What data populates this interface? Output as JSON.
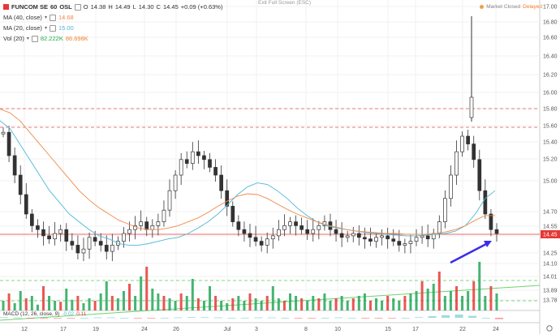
{
  "header": {
    "symbol": "FUNCOM SE",
    "interval": "60",
    "exchange": "OSL",
    "open_label": "O",
    "open": "14.38",
    "high_label": "H",
    "high": "14.49",
    "low_label": "L",
    "low": "14.30",
    "close_label": "C",
    "close": "14.45",
    "change": "+0.09 (+0.63%)",
    "exit_full_screen": "Exit Full Screen (ESC)",
    "market_status": "Market Closed",
    "delayed": "Delayed"
  },
  "indicators": {
    "ma40": {
      "label": "MA (40, close)",
      "value": "14.68",
      "color": "#f08a4b"
    },
    "ma20": {
      "label": "MA (20, close)",
      "value": "15.00",
      "color": "#4fb8d8"
    },
    "vol": {
      "label": "Vol (20)",
      "value_up": "82.222K",
      "value_down": "86.698K",
      "up_color": "#22aa44",
      "down_color": "#f08030"
    },
    "macd": {
      "label": "MACD (12, 26, close, 9)",
      "v1": "-0.02",
      "v2": "0.11"
    }
  },
  "colors": {
    "up": "#26a65b",
    "down": "#e53935",
    "candle": "#333333",
    "price_tag": "#e53935",
    "arrow": "#3a2ee8",
    "trend": "#6dd36d",
    "support": "#55cc55",
    "resistance": "#e05050"
  },
  "chart_data": {
    "type": "candlestick",
    "title": "FUNCOM SE, 60, OSL",
    "x_tick_labels": [
      "12",
      "17",
      "19",
      "24",
      "26",
      "Jul",
      "3",
      "8",
      "10",
      "15",
      "17",
      "22",
      "24"
    ],
    "y_tick_labels": [
      "17.00",
      "16.80",
      "16.60",
      "16.40",
      "16.20",
      "16.00",
      "15.80",
      "15.60",
      "15.40",
      "15.20",
      "15.00",
      "14.70",
      "14.55",
      "14.45",
      "14.25",
      "14.10",
      "14.01",
      "13.89",
      "13.78"
    ],
    "ylim": [
      13.72,
      17.02
    ],
    "last_price": 14.45,
    "resistance_levels": [
      15.8,
      15.6
    ],
    "support_levels": [
      14.2,
      14.01
    ],
    "trendline": {
      "from": [
        0,
        13.95
      ],
      "to": [
        1,
        14.17
      ]
    },
    "close_series": [
      15.75,
      15.45,
      15.2,
      14.95,
      14.7,
      14.55,
      14.5,
      14.42,
      14.38,
      14.45,
      14.5,
      14.35,
      14.3,
      14.2,
      14.25,
      14.4,
      14.35,
      14.3,
      14.22,
      14.3,
      14.35,
      14.45,
      14.5,
      14.55,
      14.6,
      14.5,
      14.55,
      14.6,
      14.75,
      15.0,
      15.2,
      15.4,
      15.35,
      15.5,
      15.45,
      15.4,
      15.3,
      15.2,
      15.0,
      14.8,
      14.6,
      14.5,
      14.45,
      14.4,
      14.35,
      14.3,
      14.38,
      14.42,
      14.5,
      14.55,
      14.6,
      14.55,
      14.5,
      14.45,
      14.5,
      14.55,
      14.6,
      14.5,
      14.45,
      14.4,
      14.42,
      14.45,
      14.4,
      14.38,
      14.35,
      14.4,
      14.42,
      14.38,
      14.35,
      14.3,
      14.32,
      14.35,
      14.4,
      14.42,
      14.38,
      14.45,
      14.6,
      14.9,
      15.2,
      15.5,
      15.7,
      15.6,
      15.4,
      15.0,
      14.7,
      14.5,
      14.45
    ],
    "ma20_series": [
      15.9,
      15.8,
      15.6,
      15.4,
      15.2,
      15.0,
      14.85,
      14.7,
      14.6,
      14.5,
      14.42,
      14.38,
      14.32,
      14.3,
      14.3,
      14.32,
      14.35,
      14.38,
      14.4,
      14.45,
      14.52,
      14.6,
      14.7,
      14.82,
      14.95,
      15.05,
      15.1,
      15.08,
      15.0,
      14.9,
      14.78,
      14.68,
      14.6,
      14.55,
      14.52,
      14.5,
      14.48,
      14.46,
      14.45,
      14.44,
      14.43,
      14.42,
      14.42,
      14.43,
      14.44,
      14.45,
      14.48,
      14.55,
      14.7,
      14.9,
      15.0
    ],
    "ma40_series": [
      16.05,
      16.0,
      15.9,
      15.75,
      15.6,
      15.45,
      15.3,
      15.15,
      15.0,
      14.88,
      14.78,
      14.7,
      14.62,
      14.57,
      14.52,
      14.5,
      14.5,
      14.52,
      14.55,
      14.6,
      14.65,
      14.72,
      14.8,
      14.87,
      14.93,
      14.96,
      14.95,
      14.9,
      14.83,
      14.76,
      14.7,
      14.65,
      14.6,
      14.56,
      14.53,
      14.5,
      14.48,
      14.47,
      14.46,
      14.45,
      14.45,
      14.44,
      14.44,
      14.44,
      14.45,
      14.47,
      14.5,
      14.55,
      14.62,
      14.68,
      14.68
    ],
    "volume_series": [
      0.2,
      0.35,
      0.15,
      0.4,
      0.25,
      0.3,
      0.12,
      0.5,
      0.3,
      0.2,
      0.18,
      0.45,
      0.22,
      0.3,
      0.15,
      0.25,
      0.2,
      0.35,
      0.6,
      0.3,
      0.25,
      0.4,
      0.55,
      0.3,
      0.7,
      0.9,
      0.45,
      0.35,
      0.3,
      0.25,
      0.2,
      0.35,
      0.3,
      0.65,
      0.25,
      0.2,
      0.5,
      0.3,
      0.2,
      0.15,
      0.25,
      0.3,
      0.2,
      0.35,
      0.25,
      0.2,
      0.3,
      0.5,
      0.25,
      0.2,
      0.35,
      0.3,
      0.25,
      0.2,
      0.3,
      0.25,
      0.35,
      0.2,
      0.25,
      0.3,
      0.2,
      0.25,
      0.3,
      0.35,
      0.2,
      0.25,
      0.2,
      0.3,
      0.25,
      0.2,
      0.3,
      0.35,
      0.4,
      0.6,
      0.45,
      0.55,
      0.8,
      0.3,
      0.4,
      0.5,
      0.3,
      0.4,
      0.6,
      1.0,
      0.3,
      0.5,
      0.35
    ],
    "macd_series": [
      0.02,
      0.01,
      -0.01,
      -0.02,
      -0.02,
      -0.01,
      0.0,
      0.01,
      0.01,
      0.0,
      -0.01,
      -0.01,
      0.0,
      0.01,
      0.02,
      0.02,
      0.01,
      0.0,
      0.0,
      0.01,
      0.01,
      0.0,
      -0.01,
      -0.01,
      0.0,
      0.01,
      0.0,
      -0.01,
      -0.02,
      -0.01,
      0.0,
      0.02,
      0.05,
      0.08,
      0.1,
      0.06,
      0.0,
      -0.04
    ]
  }
}
